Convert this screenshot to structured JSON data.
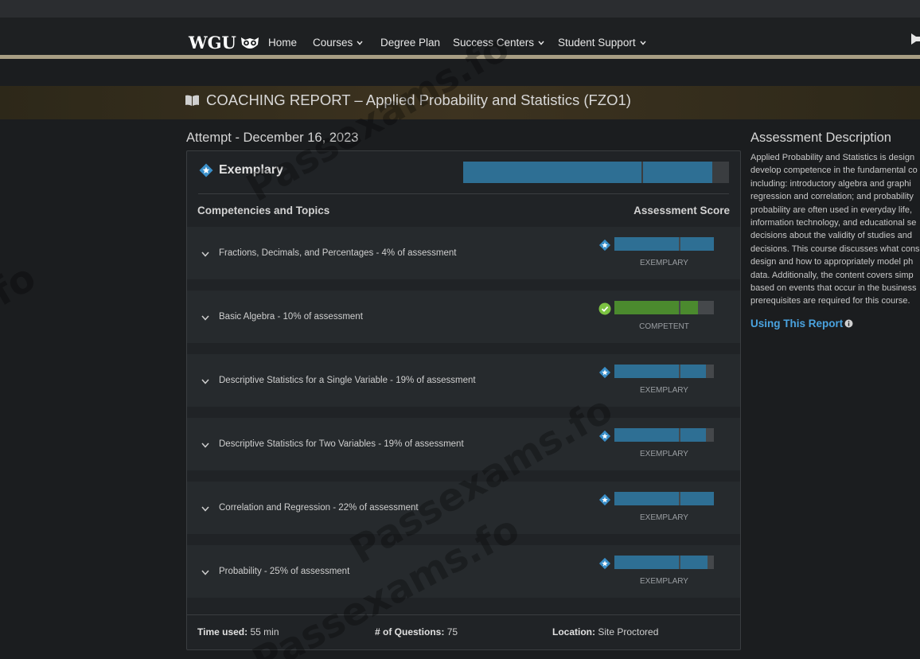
{
  "nav": {
    "logo_text": "WGU",
    "items": [
      {
        "label": "Home",
        "dropdown": false
      },
      {
        "label": "Courses",
        "dropdown": true
      },
      {
        "label": "Degree Plan",
        "dropdown": false
      },
      {
        "label": "Success Centers",
        "dropdown": true
      },
      {
        "label": "Student Support",
        "dropdown": true
      }
    ]
  },
  "banner": {
    "icon": "book-icon",
    "title": "COACHING REPORT – Applied Probability and Statistics (FZO1)"
  },
  "attempt": "Attempt - December 16, 2023",
  "overall": {
    "label": "Exemplary",
    "icon": "star-badge-icon",
    "segments": [
      0.67,
      0.26
    ],
    "color": "#2e6f94"
  },
  "table": {
    "col_topics": "Competencies and Topics",
    "col_score": "Assessment Score"
  },
  "topics": [
    {
      "label": "Fractions, Decimals, and Percentages - 4% of assessment",
      "score": "EXEMPLARY",
      "icon": "star-badge-icon",
      "color": "#2e6f94",
      "segments": [
        0.65,
        0.33
      ]
    },
    {
      "label": "Basic Algebra - 10% of assessment",
      "score": "COMPETENT",
      "icon": "check-circle-icon",
      "color": "#4b8a2e",
      "segments": [
        0.65,
        0.17
      ]
    },
    {
      "label": "Descriptive Statistics for a Single Variable - 19% of assessment",
      "score": "EXEMPLARY",
      "icon": "star-badge-icon",
      "color": "#2e6f94",
      "segments": [
        0.65,
        0.25
      ]
    },
    {
      "label": "Descriptive Statistics for Two Variables - 19% of assessment",
      "score": "EXEMPLARY",
      "icon": "star-badge-icon",
      "color": "#2e6f94",
      "segments": [
        0.65,
        0.25
      ]
    },
    {
      "label": "Correlation and Regression - 22% of assessment",
      "score": "EXEMPLARY",
      "icon": "star-badge-icon",
      "color": "#2e6f94",
      "segments": [
        0.65,
        0.33
      ]
    },
    {
      "label": "Probability - 25% of assessment",
      "score": "EXEMPLARY",
      "icon": "star-badge-icon",
      "color": "#2e6f94",
      "segments": [
        0.65,
        0.27
      ]
    }
  ],
  "footer": {
    "time_label": "Time used:",
    "time_value": "55 min",
    "questions_label": "# of Questions:",
    "questions_value": "75",
    "location_label": "Location:",
    "location_value": "Site Proctored"
  },
  "description": {
    "title": "Assessment Description",
    "lines": [
      "Applied Probability and Statistics is design",
      "develop competence in the fundamental co",
      "including: introductory algebra and graphi",
      "regression and correlation; and probability",
      "probability are often used in everyday life,",
      "information technology, and educational se",
      "decisions about the validity of studies and",
      "decisions. This course discusses what cons",
      "design and how to appropriately model ph",
      "data. Additionally, the content covers simp",
      "based on events that occur in the business",
      "prerequisites are required for this course."
    ],
    "link": "Using This Report"
  },
  "watermarks": [
    "Passexams.fo",
    "Passexams.fo",
    "Passexams.fo",
    "fo"
  ]
}
